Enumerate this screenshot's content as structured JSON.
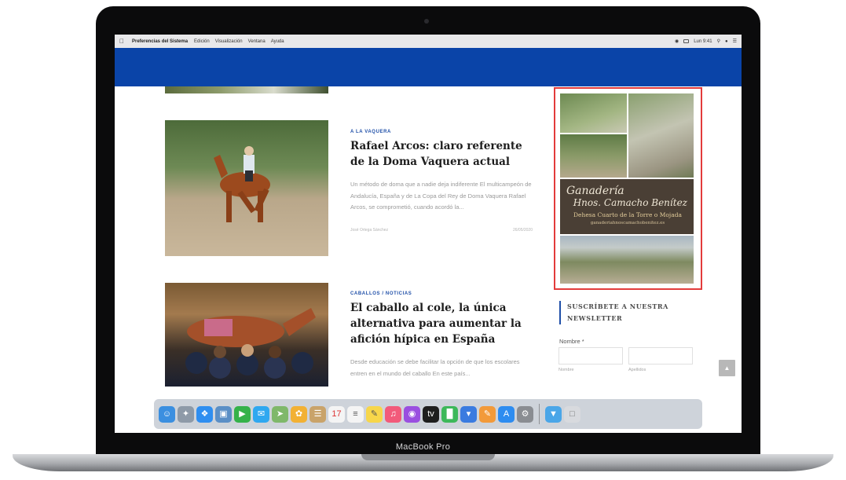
{
  "menubar": {
    "app_name": "Preferencias del Sistema",
    "items": [
      "Edición",
      "Visualización",
      "Ventana",
      "Ayuda"
    ],
    "clock": "Lun 9:41"
  },
  "posts": [
    {
      "category": "A LA VAQUERA",
      "title": "Rafael Arcos: claro referente de la Doma Vaquera actual",
      "excerpt": "Un método de doma que a nadie deja indiferente El multicampeón de Andalucía, España y de La Copa del Rey de Doma Vaquera Rafael Arcos, se comprometió, cuando acordó la...",
      "author": "José Ortega Sánchez",
      "date": "26/05/2020"
    },
    {
      "category": "CABALLOS / NOTICIAS",
      "title": "El caballo al cole, la única alternativa para aumentar la afición hípica en España",
      "excerpt": "Desde educación se debe facilitar la opción de que los escolares entren en el mundo del caballo En este país..."
    }
  ],
  "ad": {
    "line1": "Ganadería",
    "line2": "Hnos. Camacho Benítez",
    "line3": "Dehesa Cuarto de la Torre o Mojada",
    "line4": "ganaderiahnoscamachobenitez.es"
  },
  "newsletter": {
    "title": "SUSCRÍBETE A NUESTRA NEWSLETTER",
    "name_label": "Nombre *",
    "first_label": "Nombre",
    "last_label": "Apellidos"
  },
  "device_label": "MacBook Pro",
  "colors": {
    "header_blue": "#0a44a8",
    "ad_highlight": "#e33b3b",
    "category_blue": "#1f4fa8"
  },
  "dock_icons": [
    "finder-icon",
    "launchpad-icon",
    "safari-icon",
    "photos-preview-icon",
    "facetime-icon",
    "messages-icon",
    "maps-icon",
    "photos-icon",
    "notes-icon",
    "calendar-icon",
    "reminders-icon",
    "stickies-icon",
    "music-icon",
    "podcasts-icon",
    "tv-icon",
    "numbers-icon",
    "keynote-icon",
    "pages-icon",
    "app-store-icon",
    "system-preferences-icon",
    "downloads-folder-icon",
    "trash-icon"
  ]
}
